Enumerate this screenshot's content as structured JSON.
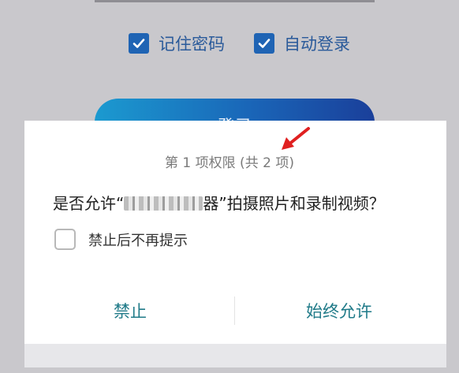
{
  "login_screen": {
    "remember_password_label": "记住密码",
    "remember_password_checked": true,
    "auto_login_label": "自动登录",
    "auto_login_checked": true,
    "login_button_label": "登录"
  },
  "permission_dialog": {
    "progress_text": "第 1 项权限 (共 2 项)",
    "question_prefix": "是否允许“",
    "app_name_tail": "器",
    "question_suffix": "”拍摄照片和录制视频？",
    "dont_ask_again_label": "禁止后不再提示",
    "dont_ask_again_checked": false,
    "deny_label": "禁止",
    "allow_label": "始终允许"
  },
  "colors": {
    "accent": "#1f7a88",
    "checkbox": "#1f64b4",
    "annotation_arrow": "#e02020"
  }
}
